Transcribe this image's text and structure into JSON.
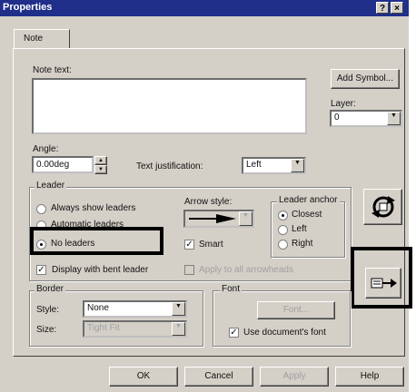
{
  "window": {
    "title": "Properties",
    "help_label": "?",
    "close_label": "×"
  },
  "tab": {
    "label": "Note"
  },
  "note": {
    "label": "Note text:",
    "value": "",
    "add_symbol_label": "Add Symbol...",
    "layer_label": "Layer:",
    "layer_value": "0"
  },
  "angle": {
    "label": "Angle:",
    "value": "0.00deg"
  },
  "text_justification": {
    "label": "Text justification:",
    "value": "Left"
  },
  "leader": {
    "group_label": "Leader",
    "options": [
      {
        "label": "Always show leaders",
        "selected": false
      },
      {
        "label": "Automatic leaders",
        "selected": false
      },
      {
        "label": "No leaders",
        "selected": true
      }
    ],
    "arrow_style_label": "Arrow style:",
    "smart_label": "Smart",
    "smart_checked": true,
    "anchor_label": "Leader anchor",
    "anchor_options": [
      {
        "label": "Closest",
        "selected": true
      },
      {
        "label": "Left",
        "selected": false
      },
      {
        "label": "Right",
        "selected": false
      }
    ],
    "bent_label": "Display with bent leader",
    "bent_checked": true,
    "apply_all_label": "Apply to all arrowheads",
    "apply_all_checked": false
  },
  "border": {
    "group_label": "Border",
    "style_label": "Style:",
    "style_value": "None",
    "size_label": "Size:",
    "size_value": "Tight Fit"
  },
  "font": {
    "group_label": "Font",
    "button_label": "Font...",
    "doc_font_label": "Use document's font",
    "doc_font_checked": true
  },
  "side_icons": {
    "top": "refresh-note-icon",
    "bottom": "note-layout-icon"
  },
  "footer": {
    "ok": "OK",
    "cancel": "Cancel",
    "apply": "Apply",
    "help": "Help"
  }
}
